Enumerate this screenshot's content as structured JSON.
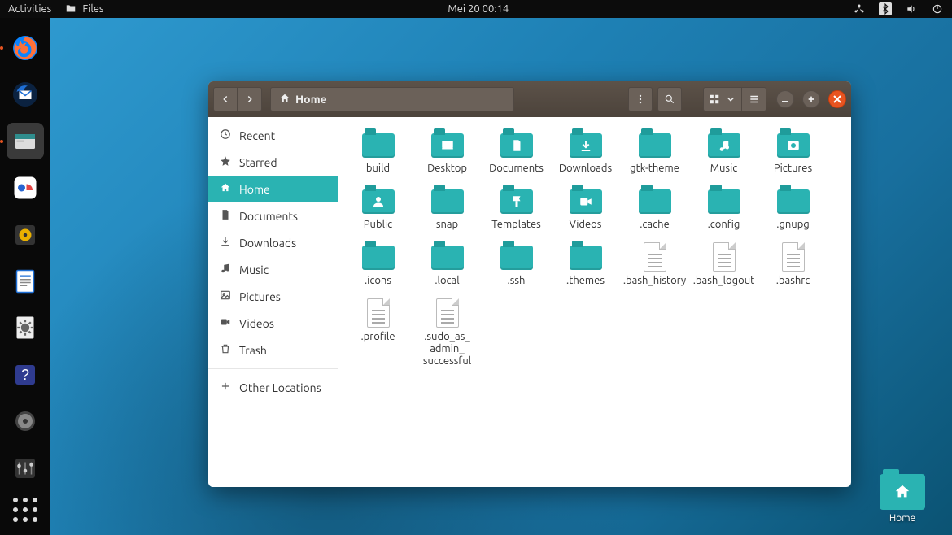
{
  "topbar": {
    "activities": "Activities",
    "app_label": "Files",
    "clock": "Mei 20  00:14"
  },
  "desktop": {
    "home_label": "Home"
  },
  "window": {
    "path_label": "Home"
  },
  "sidebar": {
    "items": [
      {
        "label": "Recent",
        "icon": "clock-icon"
      },
      {
        "label": "Starred",
        "icon": "star-icon"
      },
      {
        "label": "Home",
        "icon": "home-icon",
        "active": true
      },
      {
        "label": "Documents",
        "icon": "document-icon"
      },
      {
        "label": "Downloads",
        "icon": "download-icon"
      },
      {
        "label": "Music",
        "icon": "music-icon"
      },
      {
        "label": "Pictures",
        "icon": "picture-icon"
      },
      {
        "label": "Videos",
        "icon": "video-icon"
      },
      {
        "label": "Trash",
        "icon": "trash-icon"
      }
    ],
    "other_locations": "Other Locations"
  },
  "files": [
    {
      "name": "build",
      "type": "folder"
    },
    {
      "name": "Desktop",
      "type": "folder",
      "glyph": "desktop"
    },
    {
      "name": "Documents",
      "type": "folder",
      "glyph": "document"
    },
    {
      "name": "Downloads",
      "type": "folder",
      "glyph": "download"
    },
    {
      "name": "gtk-theme",
      "type": "folder"
    },
    {
      "name": "Music",
      "type": "folder",
      "glyph": "music"
    },
    {
      "name": "Pictures",
      "type": "folder",
      "glyph": "picture"
    },
    {
      "name": "Public",
      "type": "folder",
      "glyph": "public"
    },
    {
      "name": "snap",
      "type": "folder"
    },
    {
      "name": "Templates",
      "type": "folder",
      "glyph": "templates"
    },
    {
      "name": "Videos",
      "type": "folder",
      "glyph": "video"
    },
    {
      "name": ".cache",
      "type": "folder"
    },
    {
      "name": ".config",
      "type": "folder"
    },
    {
      "name": ".gnupg",
      "type": "folder"
    },
    {
      "name": ".icons",
      "type": "folder"
    },
    {
      "name": ".local",
      "type": "folder"
    },
    {
      "name": ".ssh",
      "type": "folder"
    },
    {
      "name": ".themes",
      "type": "folder"
    },
    {
      "name": ".bash_history",
      "type": "file"
    },
    {
      "name": ".bash_logout",
      "type": "file"
    },
    {
      "name": ".bashrc",
      "type": "file"
    },
    {
      "name": ".profile",
      "type": "file"
    },
    {
      "name": ".sudo_as_admin_successful",
      "type": "file"
    }
  ]
}
